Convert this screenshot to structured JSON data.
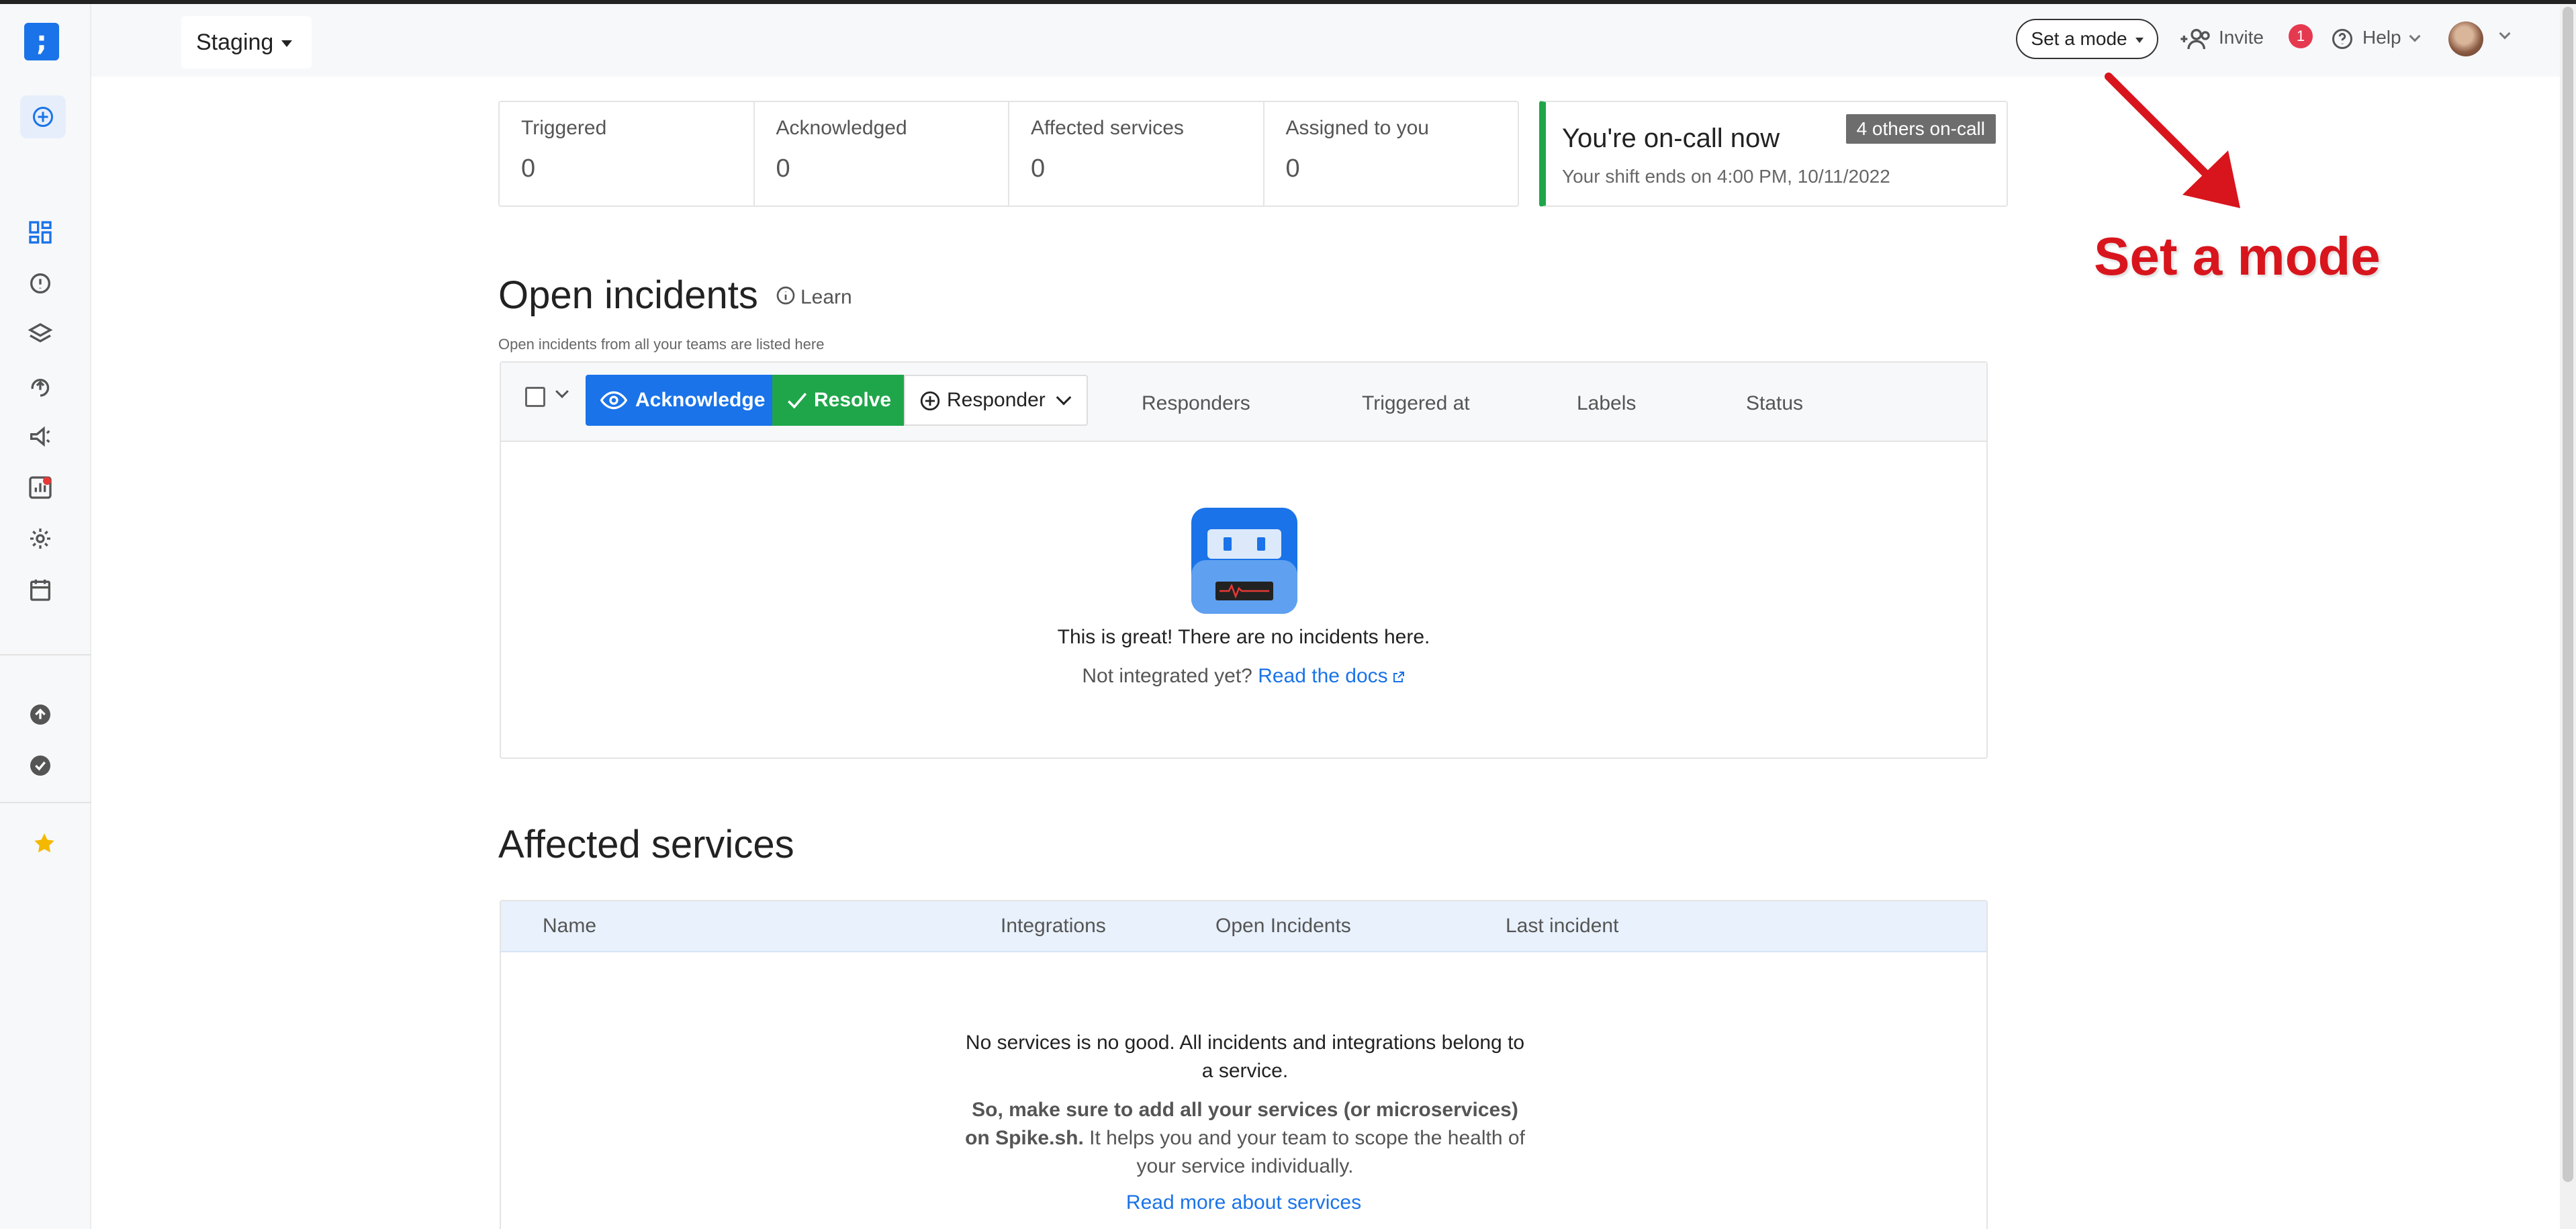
{
  "environment": {
    "label": "Staging"
  },
  "topbar": {
    "mode_label": "Set a mode",
    "invite_label": "Invite",
    "invite_badge": "1",
    "help_label": "Help"
  },
  "stats": [
    {
      "label": "Triggered",
      "value": "0"
    },
    {
      "label": "Acknowledged",
      "value": "0"
    },
    {
      "label": "Affected services",
      "value": "0"
    },
    {
      "label": "Assigned to you",
      "value": "0"
    }
  ],
  "oncall": {
    "title": "You're on-call now",
    "subtitle": "Your shift ends on 4:00 PM, 10/11/2022",
    "others_badge": "4 others on-call"
  },
  "open_incidents": {
    "title": "Open incidents",
    "learn_label": "Learn",
    "subtitle": "Open incidents from all your teams are listed here",
    "acknowledge_label": "Acknowledge",
    "resolve_label": "Resolve",
    "responder_label": "Responder",
    "columns": [
      "Responders",
      "Triggered at",
      "Labels",
      "Status"
    ],
    "empty_text": "This is great! There are no incidents here.",
    "not_integrated": "Not integrated yet?",
    "docs_link": "Read the docs"
  },
  "affected_services": {
    "title": "Affected services",
    "columns": [
      "Name",
      "Integrations",
      "Open Incidents",
      "Last incident"
    ],
    "empty_text": "No services is no good. All incidents and integrations belong to a service.",
    "advice_bold": "So, make sure to add all your services (or microservices) on Spike.sh.",
    "advice_rest": " It helps you and your team to scope the health of your service individually.",
    "read_more_link": "Read more about services"
  },
  "annotation": {
    "text": "Set a mode"
  },
  "colors": {
    "primary": "#1a73e8",
    "success": "#1fa64a",
    "danger": "#e53950",
    "annotation": "#d8151d"
  }
}
